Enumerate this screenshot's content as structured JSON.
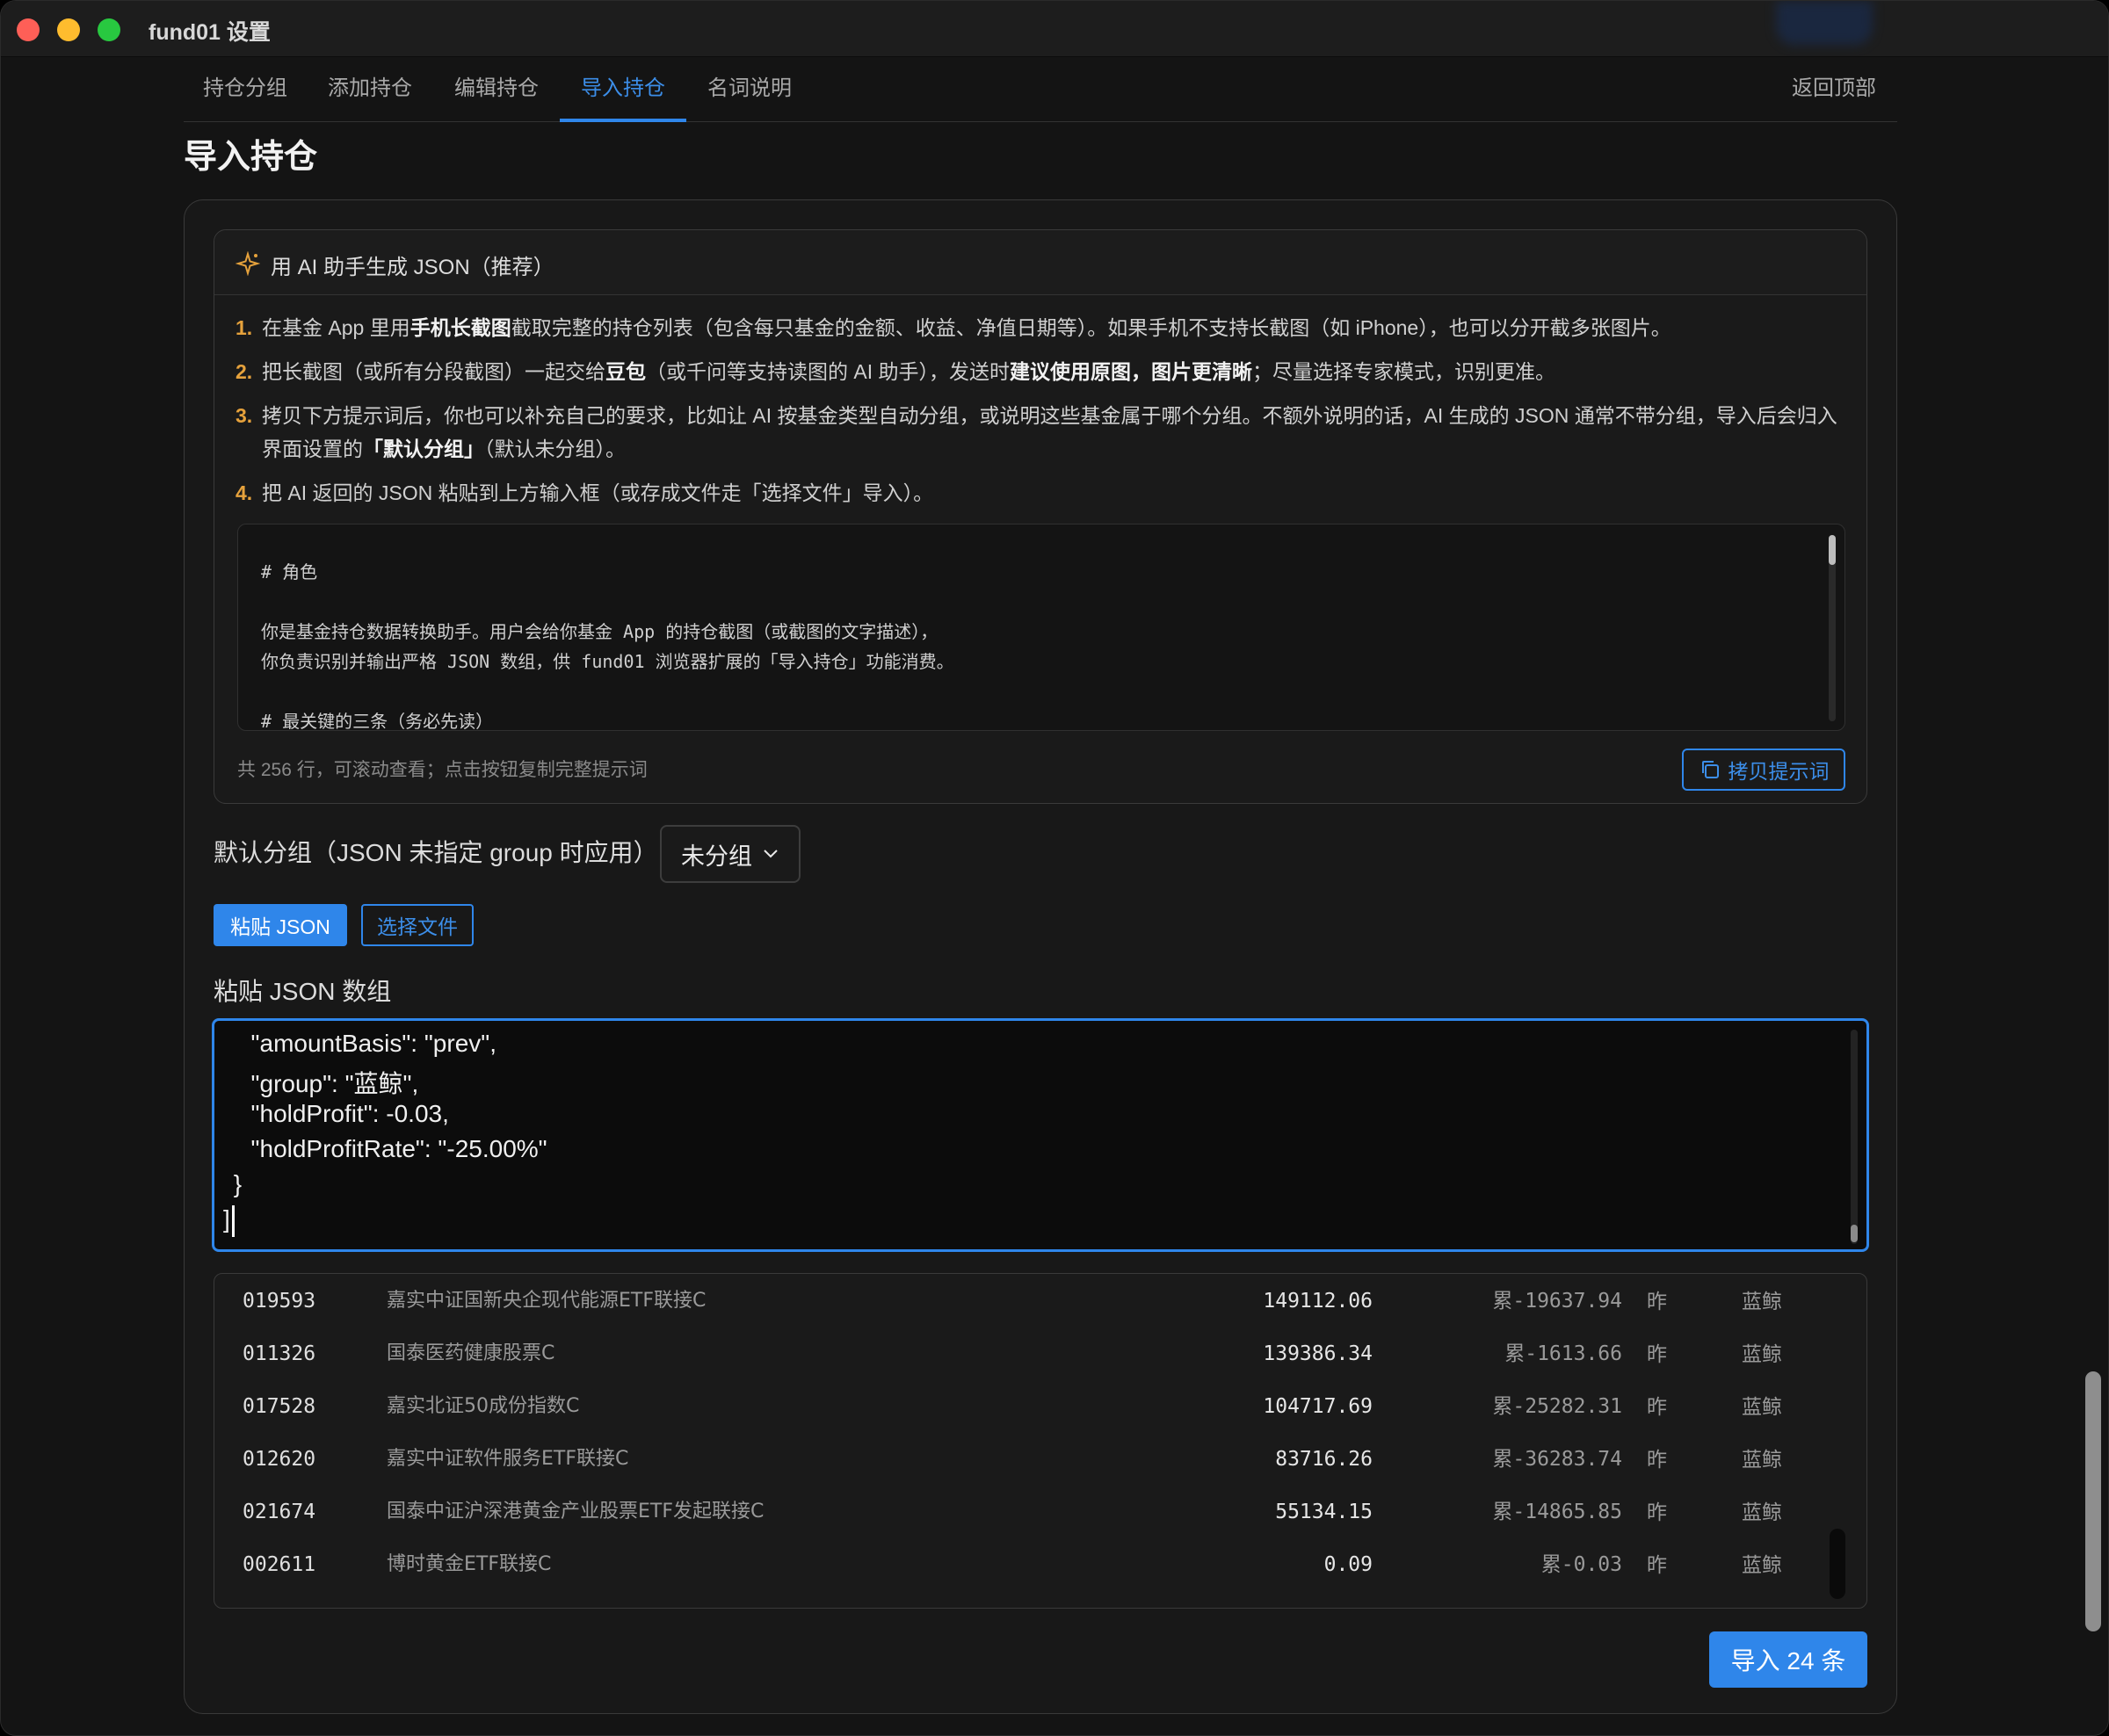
{
  "window": {
    "title": "fund01 设置"
  },
  "tabs": [
    {
      "label": "持仓分组"
    },
    {
      "label": "添加持仓"
    },
    {
      "label": "编辑持仓"
    },
    {
      "label": "导入持仓"
    },
    {
      "label": "名词说明"
    }
  ],
  "active_tab": "导入持仓",
  "back_to_top": "返回顶部",
  "page_title": "导入持仓",
  "ai_card": {
    "header": "用 AI 助手生成 JSON（推荐）",
    "steps": [
      {
        "num": "1.",
        "parts": [
          "在基金 App 里用",
          "手机长截图",
          "截取完整的持仓列表（包含每只基金的金额、收益、净值日期等）。如果手机不支持长截图（如 iPhone），也可以分开截多张图片。"
        ]
      },
      {
        "num": "2.",
        "parts": [
          "把长截图（或所有分段截图）一起交给",
          "豆包",
          "（或千问等支持读图的 AI 助手），发送时",
          "建议使用原图，图片更清晰",
          "；尽量选择专家模式，识别更准。"
        ]
      },
      {
        "num": "3.",
        "parts": [
          "拷贝下方提示词后，你也可以补充自己的要求，比如让 AI 按基金类型自动分组，或说明这些基金属于哪个分组。不额外说明的话，AI 生成的 JSON 通常不带分组，导入后会归入界面设置的",
          "「默认分组」",
          "（默认未分组）。"
        ]
      },
      {
        "num": "4.",
        "parts": [
          "把 AI 返回的 JSON 粘贴到上方输入框（或存成文件走「选择文件」导入）。"
        ]
      }
    ],
    "prompt_lines": [
      "# 角色",
      "你是基金持仓数据转换助手。用户会给你基金 App 的持仓截图（或截图的文字描述），",
      "你负责识别并输出严格 JSON 数组，供 fund01 浏览器扩展的「导入持仓」功能消费。",
      "# 最关键的三条（务必先读）"
    ],
    "prompt_footer": "共 256 行，可滚动查看；点击按钮复制完整提示词",
    "copy_button": "拷贝提示词"
  },
  "default_group": {
    "label": "默认分组（JSON 未指定 group 时应用）",
    "selected": "未分组"
  },
  "buttons": {
    "paste_json": "粘贴 JSON",
    "choose_file": "选择文件",
    "import": "导入 24 条"
  },
  "json_input": {
    "label": "粘贴 JSON 数组",
    "lines": [
      "  \"amountBasis\": \"prev\",",
      "  \"group\": \"蓝鲸\",",
      "  \"holdProfit\": -0.03,",
      "  \"holdProfitRate\": \"-25.00%\"",
      " }",
      "]"
    ]
  },
  "preview_rows": [
    {
      "code": "019593",
      "name": "嘉实中证国新央企现代能源ETF联接C",
      "amount": "149112.06",
      "profit": "累-19637.94",
      "basis": "昨",
      "group": "蓝鲸"
    },
    {
      "code": "011326",
      "name": "国泰医药健康股票C",
      "amount": "139386.34",
      "profit": "累-1613.66",
      "basis": "昨",
      "group": "蓝鲸"
    },
    {
      "code": "017528",
      "name": "嘉实北证50成份指数C",
      "amount": "104717.69",
      "profit": "累-25282.31",
      "basis": "昨",
      "group": "蓝鲸"
    },
    {
      "code": "012620",
      "name": "嘉实中证软件服务ETF联接C",
      "amount": "83716.26",
      "profit": "累-36283.74",
      "basis": "昨",
      "group": "蓝鲸"
    },
    {
      "code": "021674",
      "name": "国泰中证沪深港黄金产业股票ETF发起联接C",
      "amount": "55134.15",
      "profit": "累-14865.85",
      "basis": "昨",
      "group": "蓝鲸"
    },
    {
      "code": "002611",
      "name": "博时黄金ETF联接C",
      "amount": "0.09",
      "profit": "累-0.03",
      "basis": "昨",
      "group": "蓝鲸"
    }
  ],
  "colors": {
    "accent": "#2f86ea",
    "step_number": "#e6a23c",
    "background": "#141414"
  }
}
